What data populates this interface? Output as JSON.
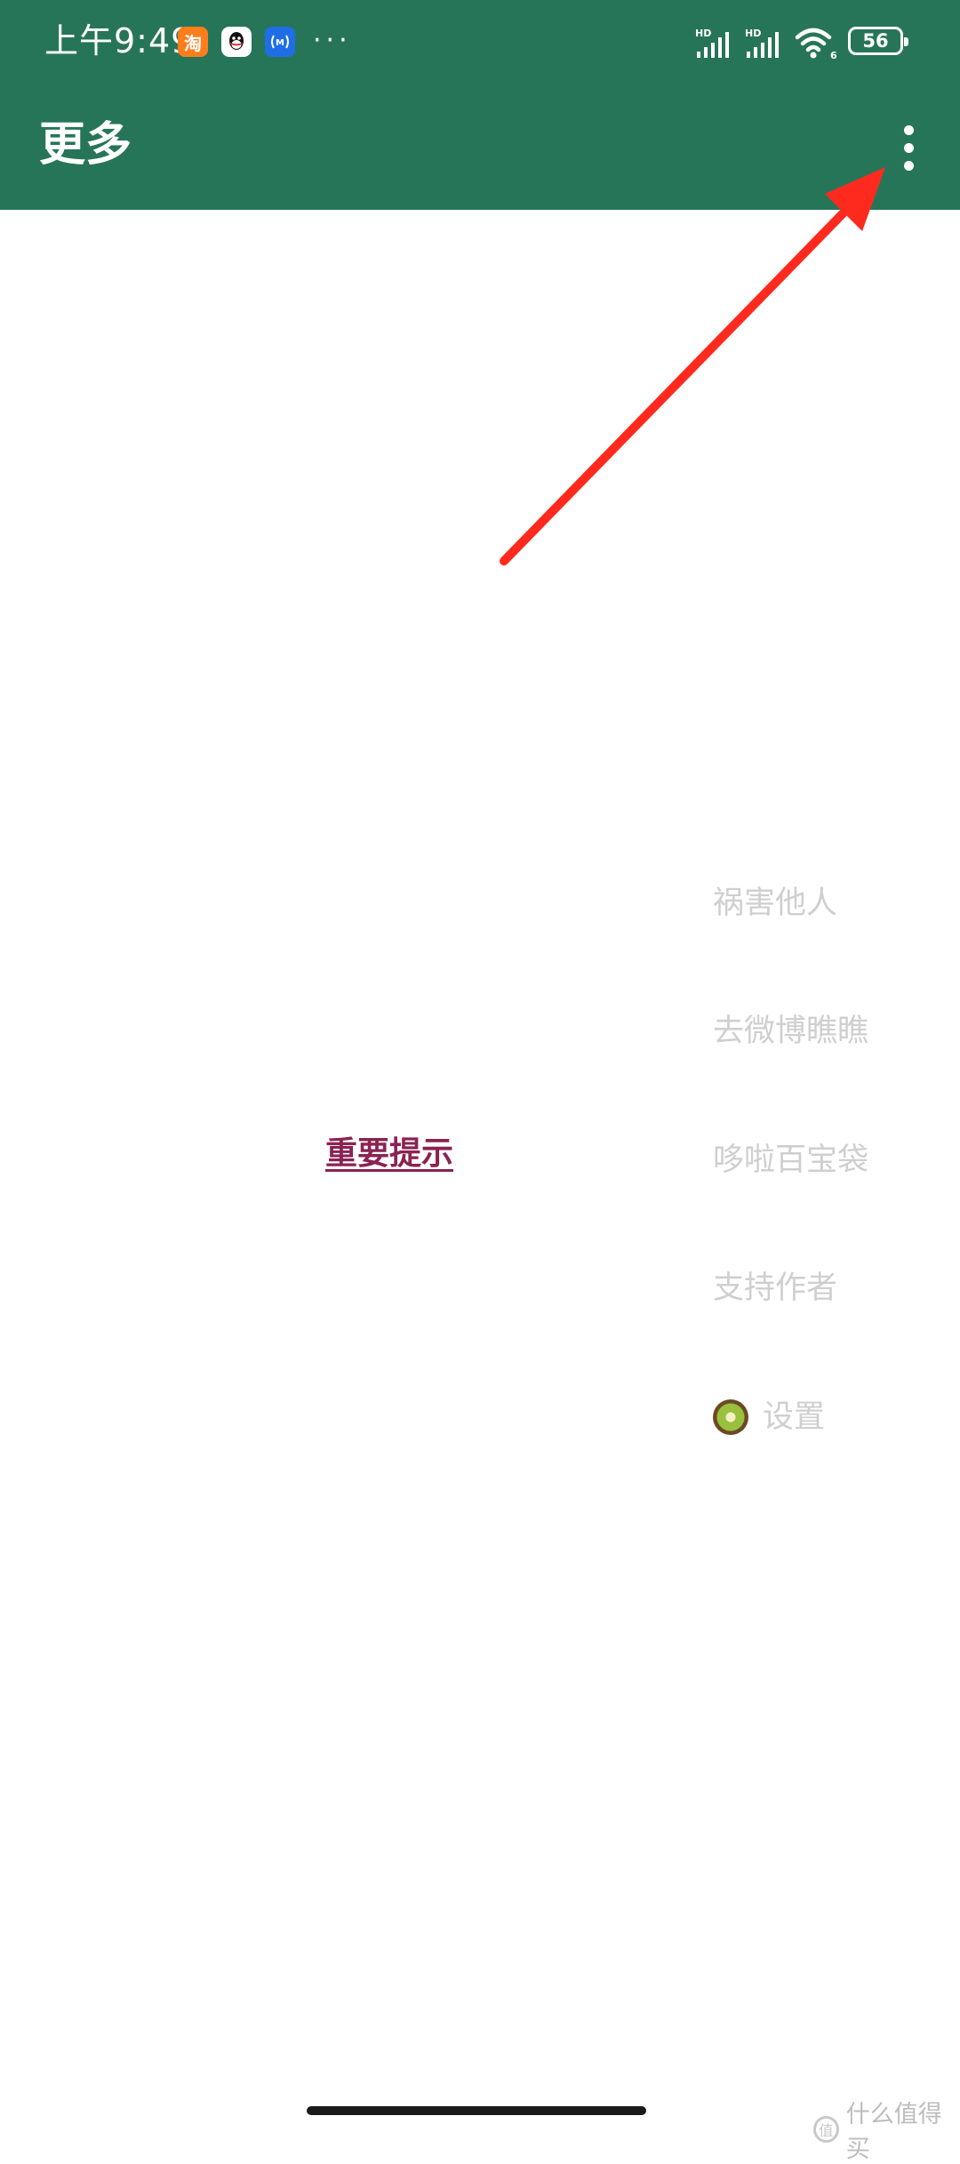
{
  "status_bar": {
    "time": "上午9:49",
    "notification_icons": [
      "taobao-icon",
      "qq-icon",
      "nfc-icon"
    ],
    "more_indicator": "···",
    "signal_1_label": "HD",
    "signal_2_label": "HD",
    "wifi_label": "6",
    "battery": "56"
  },
  "app_bar": {
    "title": "更多",
    "overflow_icon": "more-vert-icon",
    "background": "#277559"
  },
  "content": {
    "notice_link": "重要提示",
    "notice_color": "#8a2352"
  },
  "menu": {
    "items": [
      {
        "label": "祸害他人"
      },
      {
        "label": "去微博瞧瞧"
      },
      {
        "label": "哆啦百宝袋"
      },
      {
        "label": "支持作者"
      },
      {
        "label": "设置",
        "icon": "kiwi-icon"
      }
    ]
  },
  "annotation": {
    "arrow_color": "#ff2a1e"
  },
  "watermark": {
    "text": "什么值得买",
    "logo_char": "值"
  }
}
